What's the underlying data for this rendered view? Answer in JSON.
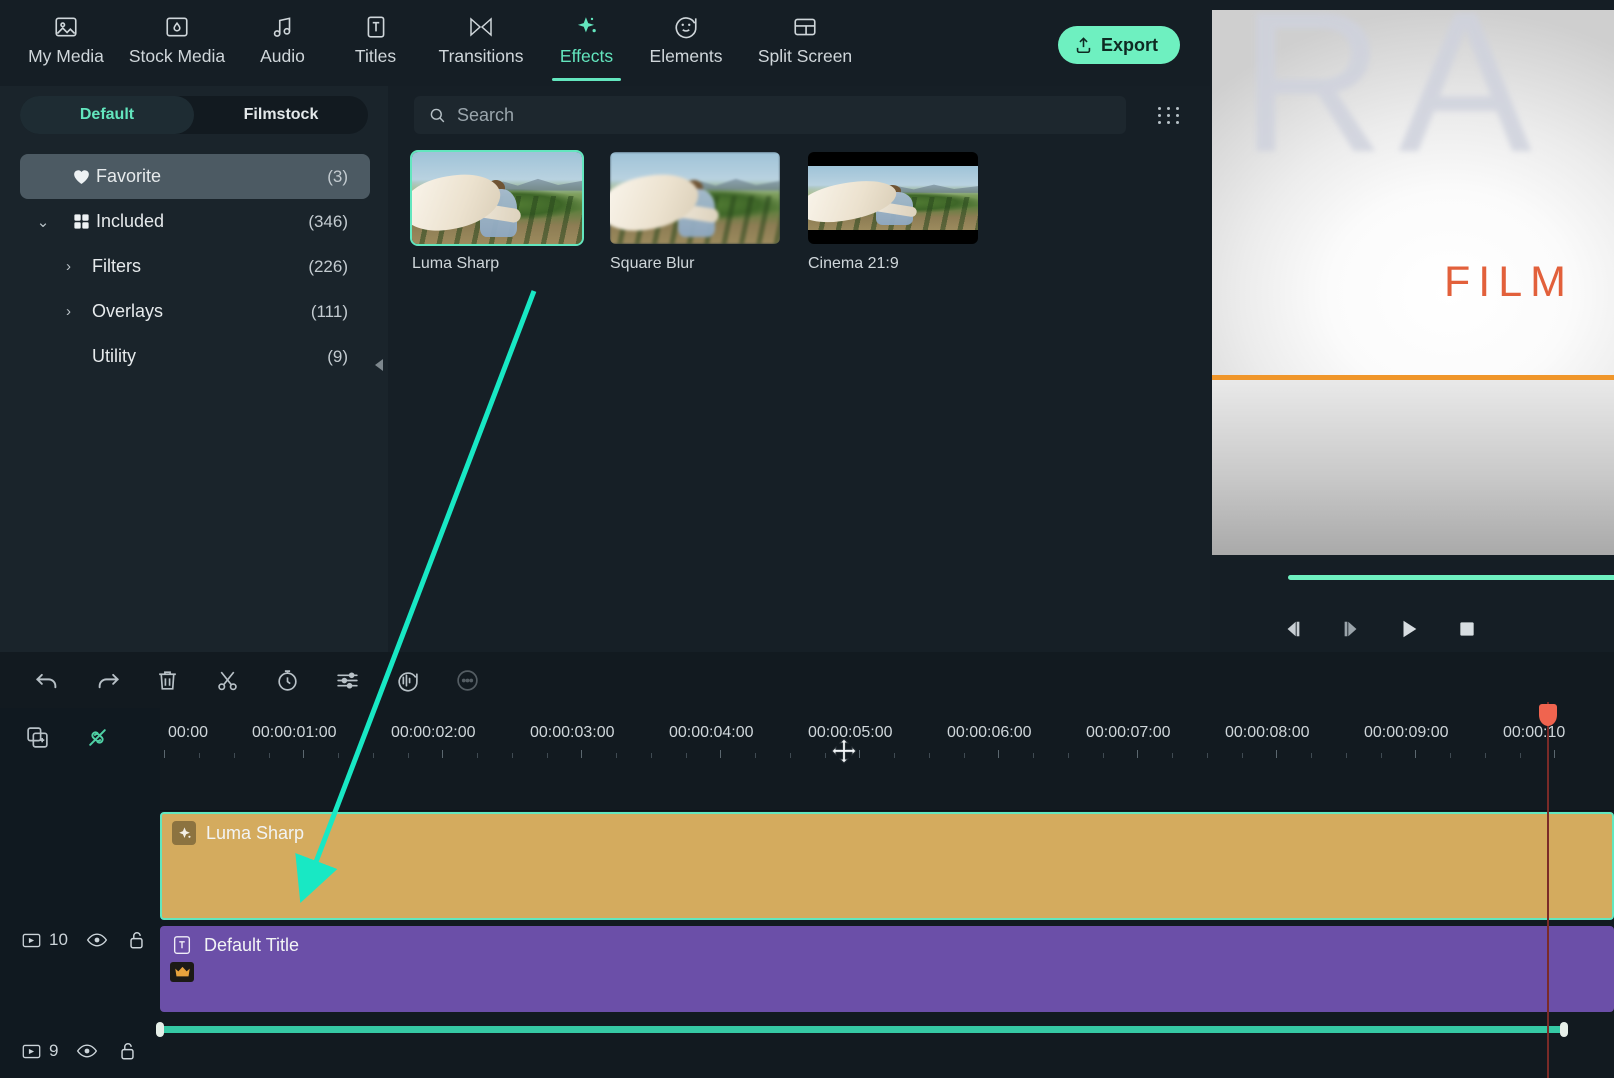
{
  "app": {
    "top_nav": [
      {
        "label": "My Media",
        "icon": "image-icon",
        "active": false
      },
      {
        "label": "Stock Media",
        "icon": "stock-media-icon",
        "active": false
      },
      {
        "label": "Audio",
        "icon": "music-note-icon",
        "active": false
      },
      {
        "label": "Titles",
        "icon": "text-box-icon",
        "active": false
      },
      {
        "label": "Transitions",
        "icon": "transition-icon",
        "active": false
      },
      {
        "label": "Effects",
        "icon": "sparkle-icon",
        "active": true
      },
      {
        "label": "Elements",
        "icon": "smiley-icon",
        "active": false
      },
      {
        "label": "Split Screen",
        "icon": "split-screen-icon",
        "active": false
      }
    ],
    "export_button": {
      "label": "Export",
      "icon": "upload-icon"
    },
    "accent_color": "#63e6be",
    "export_color": "#6ef0c0"
  },
  "sidebar": {
    "tabs": [
      {
        "label": "Default",
        "active": true
      },
      {
        "label": "Filmstock",
        "active": false
      }
    ],
    "tree": [
      {
        "label": "Favorite",
        "count": "(3)",
        "icon": "heart-icon",
        "selected": true,
        "caret": "",
        "indent": 0
      },
      {
        "label": "Included",
        "count": "(346)",
        "icon": "grid-icon",
        "selected": false,
        "caret": "⌄",
        "indent": 0
      },
      {
        "label": "Filters",
        "count": "(226)",
        "icon": "",
        "selected": false,
        "caret": "›",
        "indent": 1
      },
      {
        "label": "Overlays",
        "count": "(111)",
        "icon": "",
        "selected": false,
        "caret": "›",
        "indent": 1
      },
      {
        "label": "Utility",
        "count": "(9)",
        "icon": "",
        "selected": false,
        "caret": "",
        "indent": 1
      }
    ],
    "collapse_icon": "collapse-left-icon"
  },
  "browser": {
    "search": {
      "value": "",
      "placeholder": "Search",
      "icon": "search-icon"
    },
    "view_toggle_icon": "dot-grid-icon",
    "effects": [
      {
        "name": "Luma Sharp",
        "selected": true,
        "letterbox": false
      },
      {
        "name": "Square Blur",
        "selected": false,
        "letterbox": false
      },
      {
        "name": "Cinema 21:9",
        "selected": false,
        "letterbox": true
      }
    ]
  },
  "preview": {
    "overlay_text_top": "RA",
    "overlay_text_mid": "FILM",
    "rule_color": "#f0962a",
    "scrubber_color": "#6ef0c0",
    "controls": [
      {
        "name": "previous-frame-button",
        "icon": "step-back-icon"
      },
      {
        "name": "next-frame-button",
        "icon": "step-forward-icon"
      },
      {
        "name": "play-button",
        "icon": "play-icon"
      },
      {
        "name": "stop-button",
        "icon": "stop-icon"
      }
    ]
  },
  "timeline": {
    "toolbar": [
      {
        "name": "undo-button",
        "icon": "undo-icon",
        "dim": false
      },
      {
        "name": "redo-button",
        "icon": "redo-icon",
        "dim": false
      },
      {
        "name": "delete-button",
        "icon": "trash-icon",
        "dim": false
      },
      {
        "name": "split-button",
        "icon": "scissors-icon",
        "dim": false
      },
      {
        "name": "speed-button",
        "icon": "stopwatch-icon",
        "dim": false
      },
      {
        "name": "adjust-button",
        "icon": "sliders-icon",
        "dim": false
      },
      {
        "name": "audio-detach-button",
        "icon": "waveform-icon",
        "dim": false
      },
      {
        "name": "more-button",
        "icon": "circle-more-icon",
        "dim": true
      }
    ],
    "left_actions": [
      {
        "name": "add-track-button",
        "icon": "add-media-icon",
        "teal": false
      },
      {
        "name": "unlink-button",
        "icon": "unlink-icon",
        "teal": true
      }
    ],
    "ruler_labels": [
      "00:00",
      "00:00:01:00",
      "00:00:02:00",
      "00:00:03:00",
      "00:00:04:00",
      "00:00:05:00",
      "00:00:06:00",
      "00:00:07:00",
      "00:00:08:00",
      "00:00:09:00",
      "00:00:10"
    ],
    "tracks": [
      {
        "number": "10",
        "visible_icon": "eye-icon",
        "lock_icon": "unlock-icon",
        "clip": {
          "name": "Luma Sharp",
          "badge_icon": "effect-diamond-icon",
          "color": "#d4ab5e",
          "selected": true
        }
      },
      {
        "number": "9",
        "visible_icon": "eye-icon",
        "lock_icon": "unlock-icon",
        "clip": {
          "name": "Default Title",
          "badge_icon": "text-box-icon",
          "color": "#6b4fa8",
          "selected": false,
          "premium_icon": "crown-icon"
        }
      }
    ],
    "playhead_color": "#f0644f",
    "scrollbar_color": "#35c9a4"
  },
  "annotation": {
    "arrow_color": "#18e8c4",
    "cursor_icon": "move-cursor"
  }
}
